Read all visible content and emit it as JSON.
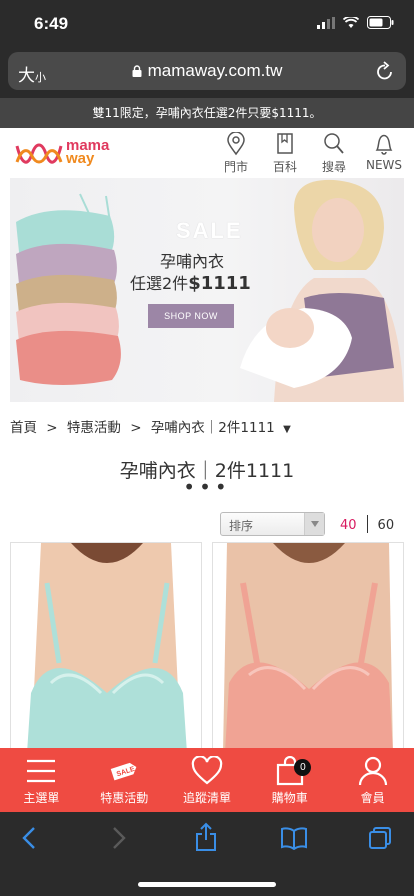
{
  "status_bar": {
    "time": "6:49"
  },
  "browser": {
    "text_size_big": "大",
    "text_size_small": "小",
    "url": "mamaway.com.tw"
  },
  "promo": {
    "text": "雙11限定，孕哺內衣任選2件只要$1111。"
  },
  "header": {
    "logo_line1": "mama",
    "logo_line2": "way",
    "nav": [
      {
        "label": "門市",
        "icon": "location-pin-icon"
      },
      {
        "label": "百科",
        "icon": "book-icon"
      },
      {
        "label": "搜尋",
        "icon": "search-icon"
      },
      {
        "label": "NEWS",
        "icon": "bell-icon"
      }
    ]
  },
  "hero": {
    "sale": "SALE",
    "line1": "孕哺內衣",
    "line2_prefix": "任選2件",
    "line2_price": "$1111",
    "button": "SHOP NOW"
  },
  "breadcrumb": {
    "items": [
      "首頁",
      "特惠活動",
      "孕哺內衣｜2件1111"
    ],
    "separator": ">",
    "dropdown_glyph": "▼"
  },
  "page": {
    "title": "孕哺內衣｜2件1111",
    "dots": "•••"
  },
  "listing": {
    "sort_label": "排序",
    "per_page_options": [
      "40",
      "60"
    ],
    "per_page_selected": "40",
    "products": [
      {
        "color_name": "mint",
        "color": "#aee0d9"
      },
      {
        "color_name": "coral",
        "color": "#f0a394"
      }
    ]
  },
  "bottom_nav": {
    "items": [
      {
        "label": "主選單",
        "icon": "menu-icon"
      },
      {
        "label": "特惠活動",
        "icon": "sale-tag-icon"
      },
      {
        "label": "追蹤清單",
        "icon": "heart-icon"
      },
      {
        "label": "購物車",
        "icon": "shopping-bag-icon"
      },
      {
        "label": "會員",
        "icon": "user-icon"
      }
    ],
    "cart_count": "0",
    "sale_tag_text": "SALE"
  },
  "colors": {
    "accent_red": "#ef4b42",
    "brand_pink": "#e03a5f",
    "brand_orange": "#f08a1f",
    "selected_pink": "#d81b60",
    "dark_bar": "#2b2b2b"
  }
}
